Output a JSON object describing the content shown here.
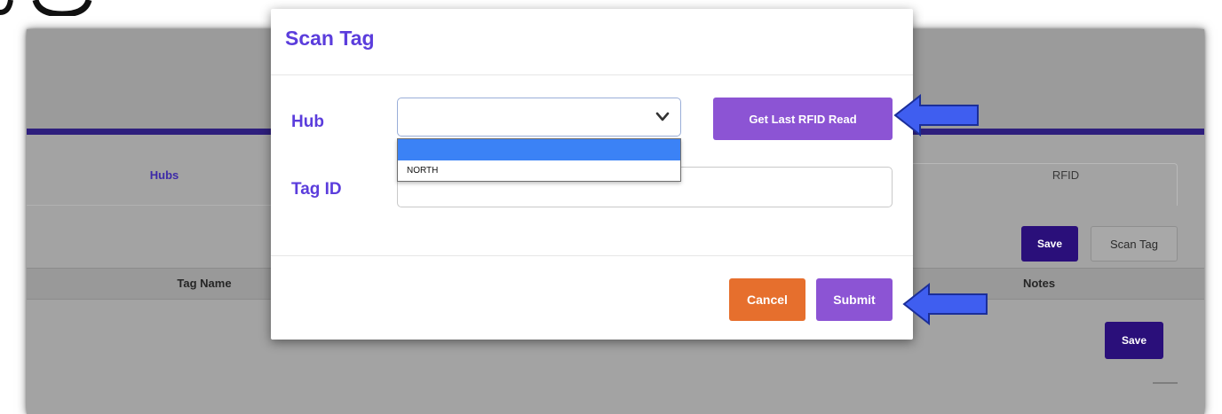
{
  "modal": {
    "title": "Scan Tag",
    "hub_label": "Hub",
    "tag_id_label": "Tag ID",
    "hub_select": {
      "selected_value": "",
      "options": [
        "",
        "NORTH"
      ]
    },
    "tag_id_value": "",
    "get_last_rfid_label": "Get Last RFID Read",
    "cancel_label": "Cancel",
    "submit_label": "Submit"
  },
  "background": {
    "tabs": [
      {
        "label": "Hubs",
        "active": true
      },
      {
        "label": "RFID",
        "active": false
      }
    ],
    "toolbar": {
      "save_label": "Save",
      "scan_tag_label": "Scan Tag"
    },
    "table": {
      "columns": [
        "Tag Name",
        "Notes"
      ]
    },
    "row_save_label": "Save"
  },
  "colors": {
    "accent_purple": "#8c54d4",
    "title_purple": "#5b3ddc",
    "dark_purple": "#2a0f7a",
    "cancel_orange": "#e66f2d",
    "callout_arrow_blue": "#3f5ef0",
    "dropdown_highlight": "#3b82f6"
  },
  "icons": {
    "select_chevron": "chevron-down-icon",
    "callout": "arrow-left-icon"
  }
}
